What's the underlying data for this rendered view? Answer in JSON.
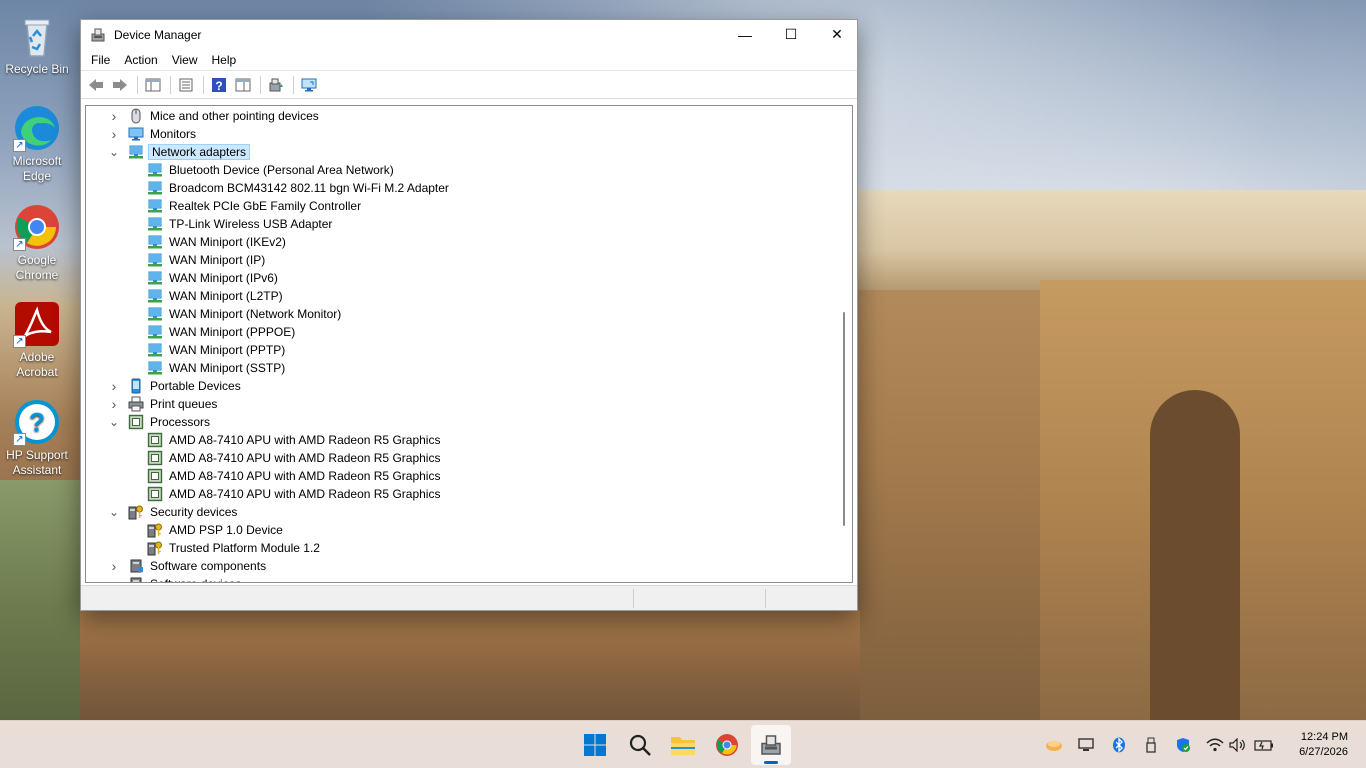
{
  "desktop": {
    "icons": [
      {
        "label": "Recycle Bin"
      },
      {
        "label": "Microsoft Edge"
      },
      {
        "label": "Google Chrome"
      },
      {
        "label": "Adobe Acrobat"
      },
      {
        "label": "HP Support Assistant"
      }
    ]
  },
  "window": {
    "title": "Device Manager",
    "controls": {
      "minimize": "—",
      "maximize": "☐",
      "close": "✕"
    },
    "menu": [
      "File",
      "Action",
      "View",
      "Help"
    ],
    "toolbar_icons": [
      "back-icon",
      "forward-icon",
      "show-hide-console-tree-icon",
      "properties-icon",
      "help-icon",
      "view-icon",
      "update-driver-icon",
      "scan-hardware-icon"
    ],
    "tree": [
      {
        "label": "Mice and other pointing devices",
        "level": 0,
        "expander": "collapsed",
        "icon": "mouse-icon"
      },
      {
        "label": "Monitors",
        "level": 0,
        "expander": "collapsed",
        "icon": "monitor-icon"
      },
      {
        "label": "Network adapters",
        "level": 0,
        "expander": "expanded",
        "icon": "network-adapter-icon",
        "selected": true
      },
      {
        "label": "Bluetooth Device (Personal Area Network)",
        "level": 1,
        "icon": "network-adapter-icon"
      },
      {
        "label": "Broadcom BCM43142 802.11 bgn Wi-Fi M.2 Adapter",
        "level": 1,
        "icon": "network-adapter-icon"
      },
      {
        "label": "Realtek PCIe GbE Family Controller",
        "level": 1,
        "icon": "network-adapter-icon"
      },
      {
        "label": "TP-Link Wireless USB Adapter",
        "level": 1,
        "icon": "network-adapter-icon"
      },
      {
        "label": "WAN Miniport (IKEv2)",
        "level": 1,
        "icon": "network-adapter-icon"
      },
      {
        "label": "WAN Miniport (IP)",
        "level": 1,
        "icon": "network-adapter-icon"
      },
      {
        "label": "WAN Miniport (IPv6)",
        "level": 1,
        "icon": "network-adapter-icon"
      },
      {
        "label": "WAN Miniport (L2TP)",
        "level": 1,
        "icon": "network-adapter-icon"
      },
      {
        "label": "WAN Miniport (Network Monitor)",
        "level": 1,
        "icon": "network-adapter-icon"
      },
      {
        "label": "WAN Miniport (PPPOE)",
        "level": 1,
        "icon": "network-adapter-icon"
      },
      {
        "label": "WAN Miniport (PPTP)",
        "level": 1,
        "icon": "network-adapter-icon"
      },
      {
        "label": "WAN Miniport (SSTP)",
        "level": 1,
        "icon": "network-adapter-icon"
      },
      {
        "label": "Portable Devices",
        "level": 0,
        "expander": "collapsed",
        "icon": "portable-device-icon"
      },
      {
        "label": "Print queues",
        "level": 0,
        "expander": "collapsed",
        "icon": "printer-icon"
      },
      {
        "label": "Processors",
        "level": 0,
        "expander": "expanded",
        "icon": "processor-icon"
      },
      {
        "label": "AMD A8-7410 APU with AMD Radeon R5 Graphics",
        "level": 1,
        "icon": "processor-icon"
      },
      {
        "label": "AMD A8-7410 APU with AMD Radeon R5 Graphics",
        "level": 1,
        "icon": "processor-icon"
      },
      {
        "label": "AMD A8-7410 APU with AMD Radeon R5 Graphics",
        "level": 1,
        "icon": "processor-icon"
      },
      {
        "label": "AMD A8-7410 APU with AMD Radeon R5 Graphics",
        "level": 1,
        "icon": "processor-icon"
      },
      {
        "label": "Security devices",
        "level": 0,
        "expander": "expanded",
        "icon": "security-device-icon"
      },
      {
        "label": "AMD PSP 1.0 Device",
        "level": 1,
        "icon": "security-device-icon"
      },
      {
        "label": "Trusted Platform Module 1.2",
        "level": 1,
        "icon": "security-device-icon"
      },
      {
        "label": "Software components",
        "level": 0,
        "expander": "collapsed",
        "icon": "software-component-icon"
      },
      {
        "label": "Software devices",
        "level": 0,
        "expander": "collapsed",
        "icon": "software-device-icon"
      }
    ]
  },
  "taskbar": {
    "apps": [
      "start-icon",
      "search-icon",
      "file-explorer-icon",
      "chrome-icon",
      "device-manager-icon"
    ],
    "active_app": "device-manager-icon",
    "tray_icons": [
      "weather-icon",
      "display-icon",
      "bluetooth-icon",
      "usb-icon",
      "security-icon",
      "wifi-icon",
      "volume-icon",
      "battery-icon"
    ],
    "time": "12:24 PM",
    "date": "6/27/2026"
  },
  "colors": {
    "selection_bg": "#cce8ff",
    "selection_border": "#99d1ff",
    "network_icon": "#2a8fd6",
    "processor_icon": "#3f6b3a",
    "accent": "#0067c0"
  }
}
